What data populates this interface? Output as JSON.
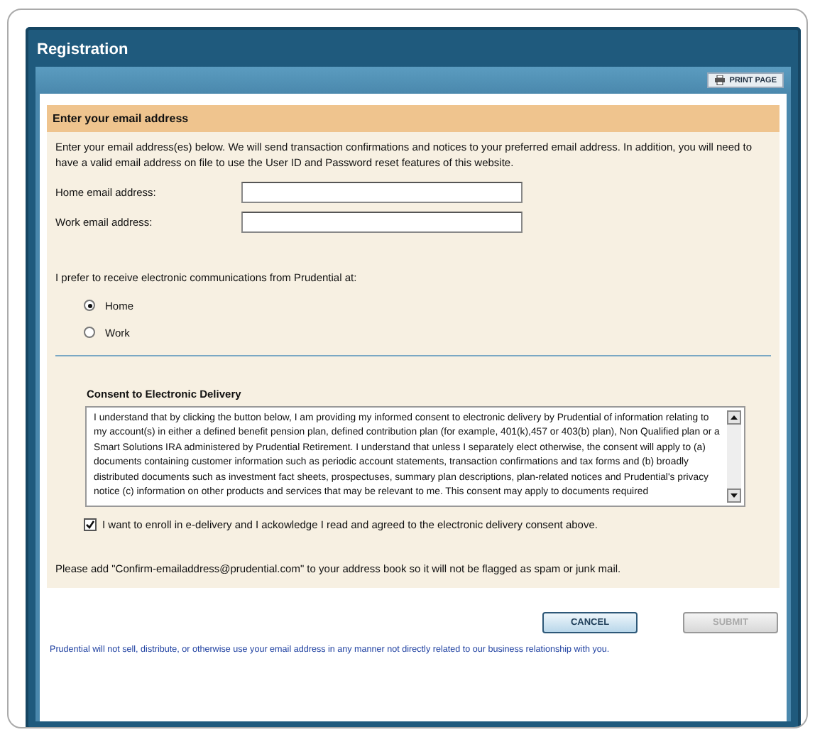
{
  "window": {
    "title": "Registration"
  },
  "print_button": {
    "label": "PRINT PAGE"
  },
  "section": {
    "title": "Enter your email address",
    "intro": "Enter your email address(es) below. We will send transaction confirmations and notices to your preferred email address. In addition, you will need to have a valid email address on file to use the User ID and Password reset features of this website.",
    "fields": [
      {
        "label": "Home email address:"
      },
      {
        "label": "Work email address:"
      }
    ],
    "preference_label": "I prefer to receive electronic communications from Prudential at:",
    "options": [
      {
        "label": "Home",
        "selected": true
      },
      {
        "label": "Work",
        "selected": false
      }
    ],
    "consent": {
      "title": "Consent to Electronic Delivery",
      "text": "I understand that by clicking the button below, I am providing my informed consent to electronic delivery by Prudential of information relating to my account(s) in either a defined benefit pension plan, defined contribution plan (for example, 401(k),457 or 403(b) plan), Non Qualified plan or a Smart Solutions IRA administered by Prudential Retirement.  I understand that unless I separately elect otherwise, the consent will apply to (a) documents containing customer information such as periodic account statements, transaction confirmations and tax forms and (b) broadly distributed documents such as investment fact sheets, prospectuses, summary plan descriptions, plan-related notices and Prudential's privacy notice (c) information on other products and services that may be relevant to me. This consent may apply to documents required"
    },
    "agree": {
      "label": "I want to enroll in e-delivery and I ackowledge I read and agreed to the electronic delivery consent above.",
      "checked": true
    },
    "note": "Please add \"Confirm-emailaddress@prudential.com\" to your address book so it will not be flagged as spam or junk mail."
  },
  "buttons": [
    {
      "label": "CANCEL",
      "disabled": false
    },
    {
      "label": "SUBMIT",
      "disabled": true
    }
  ],
  "footer": "Prudential will not sell, distribute, or otherwise use your email address in any manner not directly related to our business relationship with you."
}
